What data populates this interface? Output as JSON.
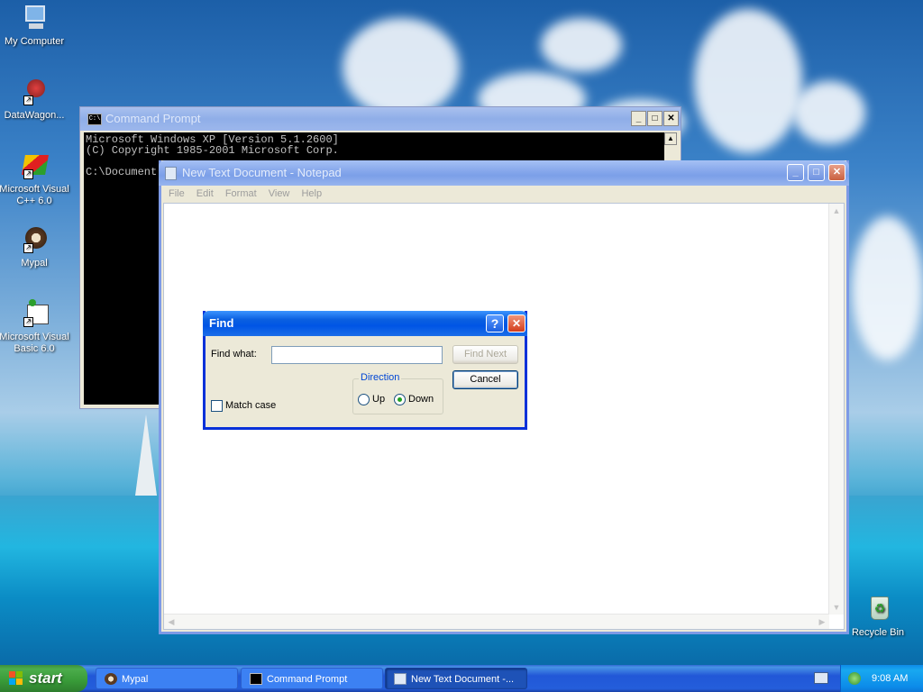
{
  "desktop": {
    "icons": [
      {
        "label": "My Computer"
      },
      {
        "label": "DataWagon..."
      },
      {
        "label": "Microsoft Visual C++ 6.0"
      },
      {
        "label": "Mypal"
      },
      {
        "label": "Microsoft Visual Basic 6.0"
      },
      {
        "label": "Recycle Bin"
      }
    ]
  },
  "cmd": {
    "title": "Command Prompt",
    "lines": [
      "Microsoft Windows XP [Version 5.1.2600]",
      "(C) Copyright 1985-2001 Microsoft Corp.",
      "",
      "C:\\Document"
    ],
    "icon_text": "C:\\"
  },
  "notepad": {
    "title": "New Text Document - Notepad",
    "menu": [
      "File",
      "Edit",
      "Format",
      "View",
      "Help"
    ]
  },
  "find": {
    "title": "Find",
    "find_what_label": "Find what:",
    "find_what_value": "",
    "find_next_label": "Find Next",
    "cancel_label": "Cancel",
    "direction_label": "Direction",
    "up_label": "Up",
    "down_label": "Down",
    "direction_selected": "Down",
    "match_case_label": "Match case",
    "match_case_checked": false
  },
  "taskbar": {
    "start_label": "start",
    "tasks": [
      {
        "label": "Mypal",
        "active": false
      },
      {
        "label": "Command Prompt",
        "active": false
      },
      {
        "label": "New Text Document -...",
        "active": true
      }
    ],
    "clock": "9:08 AM"
  },
  "colors": {
    "xp_blue": "#0055e5",
    "start_green": "#3c8f3c"
  }
}
